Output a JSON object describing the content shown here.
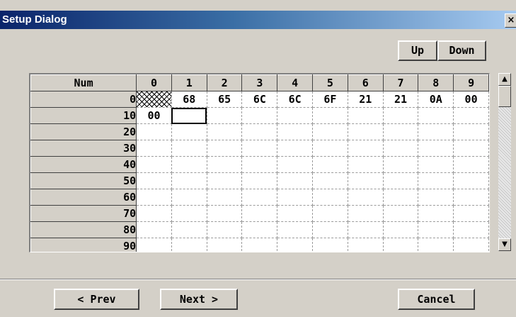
{
  "window": {
    "title": "Setup Dialog",
    "close_glyph": "×"
  },
  "nav": {
    "up_label": "Up",
    "down_label": "Down"
  },
  "grid": {
    "corner_label": "Num",
    "columns": [
      "0",
      "1",
      "2",
      "3",
      "4",
      "5",
      "6",
      "7",
      "8",
      "9"
    ],
    "rows": [
      {
        "label": "0",
        "cells": [
          "",
          "68",
          "65",
          "6C",
          "6C",
          "6F",
          "21",
          "21",
          "0A",
          "00"
        ]
      },
      {
        "label": "10",
        "cells": [
          "00",
          "",
          "",
          "",
          "",
          "",
          "",
          "",
          "",
          ""
        ]
      },
      {
        "label": "20",
        "cells": [
          "",
          "",
          "",
          "",
          "",
          "",
          "",
          "",
          "",
          ""
        ]
      },
      {
        "label": "30",
        "cells": [
          "",
          "",
          "",
          "",
          "",
          "",
          "",
          "",
          "",
          ""
        ]
      },
      {
        "label": "40",
        "cells": [
          "",
          "",
          "",
          "",
          "",
          "",
          "",
          "",
          "",
          ""
        ]
      },
      {
        "label": "50",
        "cells": [
          "",
          "",
          "",
          "",
          "",
          "",
          "",
          "",
          "",
          ""
        ]
      },
      {
        "label": "60",
        "cells": [
          "",
          "",
          "",
          "",
          "",
          "",
          "",
          "",
          "",
          ""
        ]
      },
      {
        "label": "70",
        "cells": [
          "",
          "",
          "",
          "",
          "",
          "",
          "",
          "",
          "",
          ""
        ]
      },
      {
        "label": "80",
        "cells": [
          "",
          "",
          "",
          "",
          "",
          "",
          "",
          "",
          "",
          ""
        ]
      },
      {
        "label": "90",
        "cells": [
          "",
          "",
          "",
          "",
          "",
          "",
          "",
          "",
          "",
          ""
        ]
      }
    ]
  },
  "scrollbar": {
    "up_glyph": "▲",
    "down_glyph": "▼"
  },
  "footer": {
    "prev_label": "< Prev",
    "next_label": "Next >",
    "cancel_label": "Cancel"
  },
  "colors": {
    "face": "#d4d0c8",
    "title_start": "#0a246a",
    "title_end": "#a6caf0"
  }
}
